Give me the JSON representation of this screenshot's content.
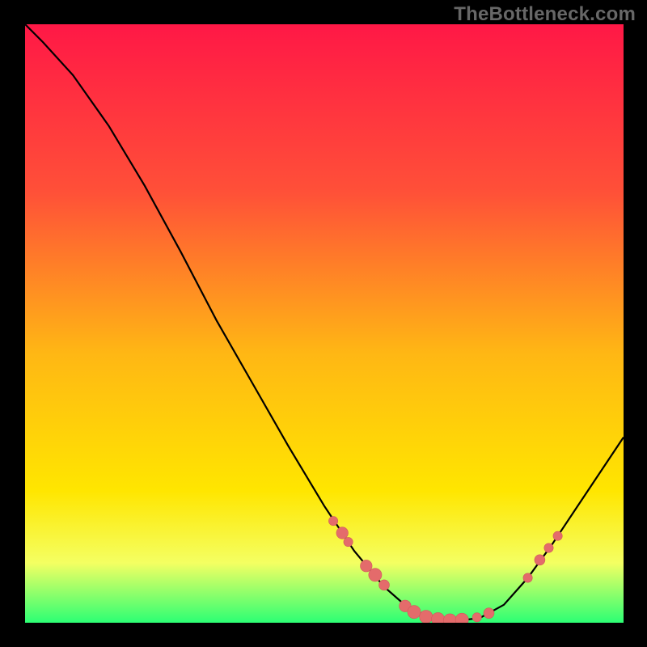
{
  "watermark": "TheBottleneck.com",
  "colors": {
    "background": "#000000",
    "gradient_top": "#ff1846",
    "gradient_upper": "#ff5038",
    "gradient_mid": "#ffb714",
    "gradient_lower": "#ffe600",
    "gradient_band": "#f4ff62",
    "gradient_bottom": "#2cff74",
    "curve": "#000000",
    "marker": "#e46b6b",
    "marker_stroke": "#cf5b5b"
  },
  "chart_data": {
    "type": "line",
    "title": "",
    "xlabel": "",
    "ylabel": "",
    "xlim": [
      0,
      100
    ],
    "ylim": [
      0,
      100
    ],
    "curve": [
      {
        "x": 0.0,
        "y": 100.0
      },
      {
        "x": 3.0,
        "y": 97.0
      },
      {
        "x": 8.0,
        "y": 91.5
      },
      {
        "x": 14.0,
        "y": 83.0
      },
      {
        "x": 20.0,
        "y": 73.0
      },
      {
        "x": 26.0,
        "y": 62.0
      },
      {
        "x": 32.0,
        "y": 50.5
      },
      {
        "x": 38.0,
        "y": 40.0
      },
      {
        "x": 44.0,
        "y": 29.5
      },
      {
        "x": 50.0,
        "y": 19.5
      },
      {
        "x": 55.0,
        "y": 12.0
      },
      {
        "x": 60.0,
        "y": 6.0
      },
      {
        "x": 64.0,
        "y": 2.5
      },
      {
        "x": 68.0,
        "y": 0.8
      },
      {
        "x": 72.0,
        "y": 0.3
      },
      {
        "x": 76.0,
        "y": 0.8
      },
      {
        "x": 80.0,
        "y": 3.0
      },
      {
        "x": 84.0,
        "y": 7.5
      },
      {
        "x": 88.0,
        "y": 13.0
      },
      {
        "x": 92.0,
        "y": 19.0
      },
      {
        "x": 96.0,
        "y": 25.0
      },
      {
        "x": 100.0,
        "y": 31.0
      }
    ],
    "markers": [
      {
        "x": 51.5,
        "y": 17.0,
        "r": 0.9
      },
      {
        "x": 53.0,
        "y": 15.0,
        "r": 1.3
      },
      {
        "x": 54.0,
        "y": 13.5,
        "r": 0.9
      },
      {
        "x": 57.0,
        "y": 9.5,
        "r": 1.3
      },
      {
        "x": 58.5,
        "y": 8.0,
        "r": 1.5
      },
      {
        "x": 60.0,
        "y": 6.3,
        "r": 1.1
      },
      {
        "x": 63.5,
        "y": 2.8,
        "r": 1.3
      },
      {
        "x": 65.0,
        "y": 1.8,
        "r": 1.5
      },
      {
        "x": 67.0,
        "y": 1.0,
        "r": 1.5
      },
      {
        "x": 69.0,
        "y": 0.6,
        "r": 1.5
      },
      {
        "x": 71.0,
        "y": 0.4,
        "r": 1.5
      },
      {
        "x": 73.0,
        "y": 0.5,
        "r": 1.5
      },
      {
        "x": 75.5,
        "y": 0.9,
        "r": 0.9
      },
      {
        "x": 77.5,
        "y": 1.6,
        "r": 1.1
      },
      {
        "x": 84.0,
        "y": 7.5,
        "r": 0.9
      },
      {
        "x": 86.0,
        "y": 10.5,
        "r": 1.1
      },
      {
        "x": 87.5,
        "y": 12.5,
        "r": 0.9
      },
      {
        "x": 89.0,
        "y": 14.5,
        "r": 0.9
      }
    ]
  }
}
